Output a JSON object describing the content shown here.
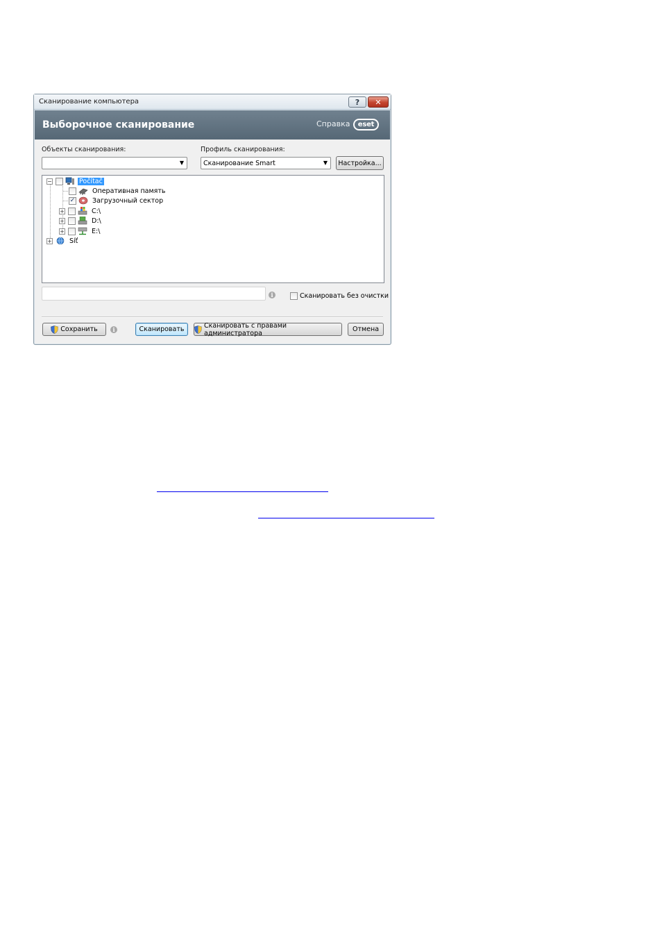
{
  "window": {
    "title": "Сканирование компьютера",
    "help_button": "?",
    "close_button": "✕"
  },
  "header": {
    "title": "Выборочное сканирование",
    "help_link": "Справка",
    "logo": "eset"
  },
  "targets": {
    "label": "Объекты сканирования:",
    "value": ""
  },
  "profile": {
    "label": "Профиль сканирования:",
    "value": "Сканирование Smart",
    "setup_button": "Настройка..."
  },
  "tree": {
    "root": {
      "label": "Počítač",
      "checked": false,
      "expanded": true,
      "selected": true
    },
    "children": [
      {
        "label": "Оперативная память",
        "checked": false,
        "expandable": false
      },
      {
        "label": "Загрузочный сектор",
        "checked": true,
        "expandable": false
      },
      {
        "label": "C:\\",
        "checked": false,
        "expandable": true
      },
      {
        "label": "D:\\",
        "checked": false,
        "expandable": true
      },
      {
        "label": "E:\\",
        "checked": false,
        "expandable": true
      }
    ],
    "network": {
      "label": "Síť",
      "expandable": true
    }
  },
  "path_input": {
    "value": ""
  },
  "no_clean_checkbox": {
    "label": "Сканировать без очистки",
    "checked": false
  },
  "buttons": {
    "save": "Сохранить",
    "scan": "Сканировать",
    "scan_admin": "Сканировать с правами администратора",
    "cancel": "Отмена"
  },
  "colors": {
    "header_bg": "#5f7180",
    "selection": "#3399ff",
    "link": "#0000ee"
  }
}
